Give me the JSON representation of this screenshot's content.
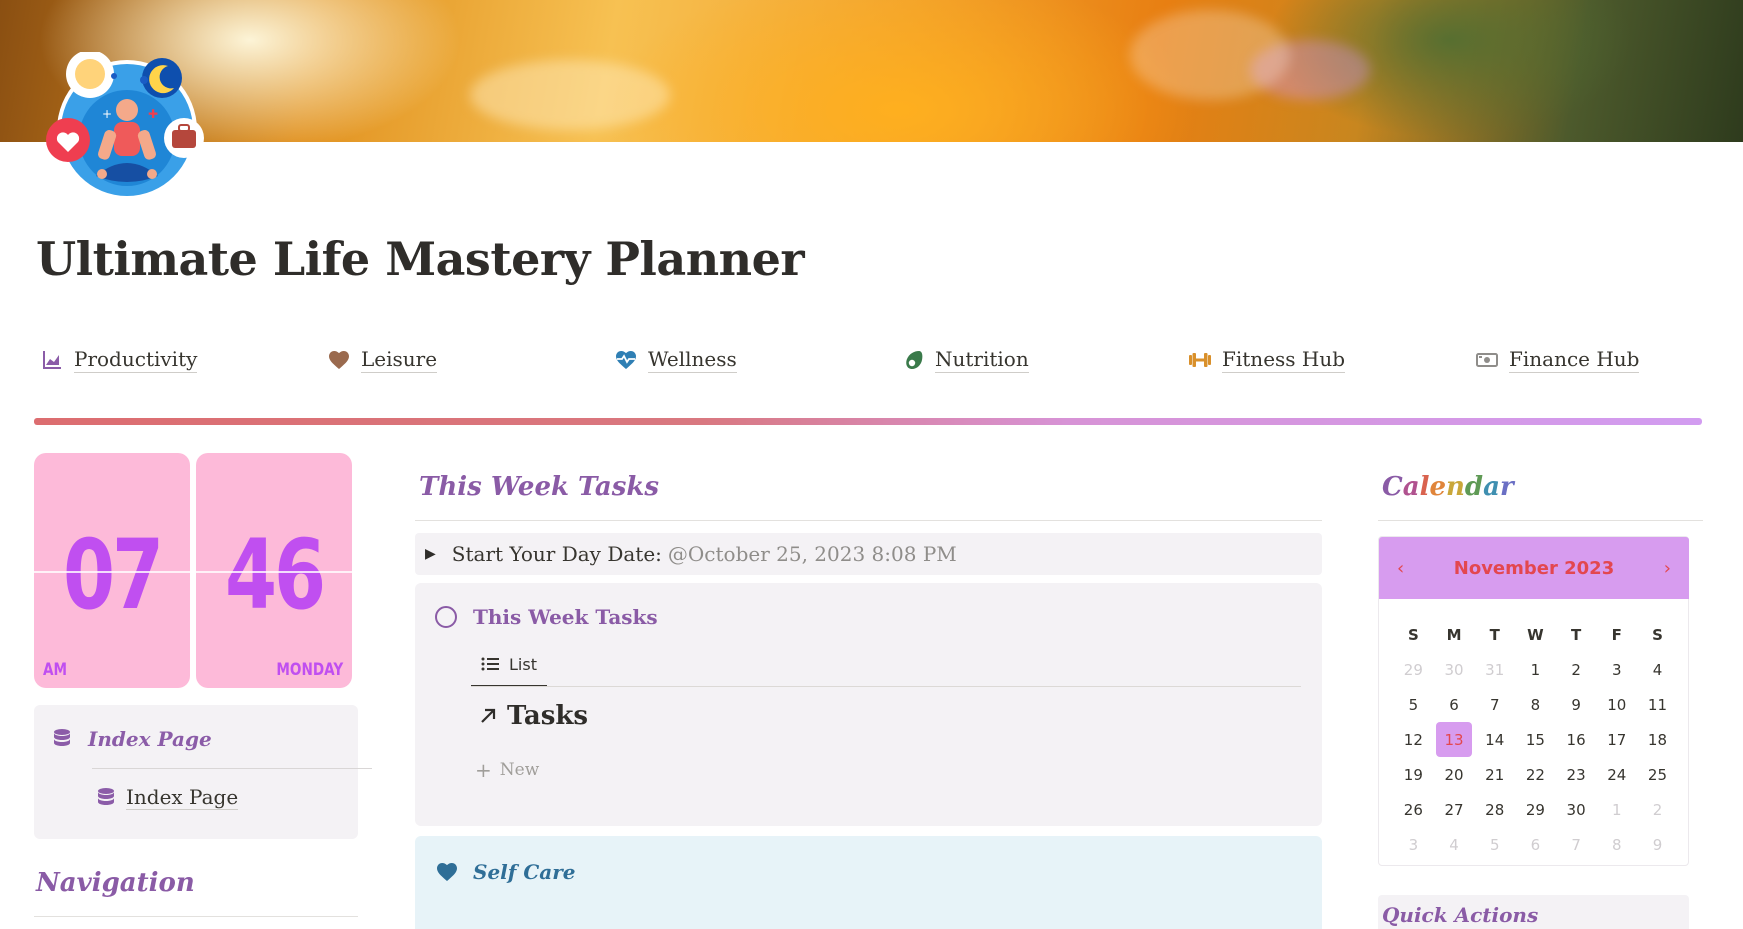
{
  "page": {
    "title": "Ultimate Life Mastery Planner"
  },
  "nav_links": [
    {
      "label": "Productivity",
      "icon": "chart-icon",
      "color": "#8b5ca8"
    },
    {
      "label": "Leisure",
      "icon": "heart-icon",
      "color": "#9a6a4e"
    },
    {
      "label": "Wellness",
      "icon": "heartbeat-icon",
      "color": "#2f7fb4"
    },
    {
      "label": "Nutrition",
      "icon": "avocado-icon",
      "color": "#3a7a4a"
    },
    {
      "label": "Fitness Hub",
      "icon": "dumbbell-icon",
      "color": "#d9902b"
    },
    {
      "label": "Finance Hub",
      "icon": "money-icon",
      "color": "#8f8d8a"
    }
  ],
  "clock": {
    "hour": "07",
    "minute": "46",
    "meridiem": "AM",
    "weekday": "MONDAY"
  },
  "index_section": {
    "heading": "Index Page",
    "item": "Index Page"
  },
  "navigation": {
    "heading": "Navigation"
  },
  "week": {
    "heading": "This Week Tasks",
    "toggle_label": "Start Your Day Date:",
    "toggle_value": "@October 25, 2023 8:08 PM",
    "card_heading": "This Week Tasks",
    "view_tab": "List",
    "database_title": "Tasks",
    "new_label": "New"
  },
  "self_care": {
    "heading": "Self Care"
  },
  "calendar": {
    "heading": "Calendar",
    "month_label": "November 2023",
    "prev": "‹",
    "next": "›",
    "weekdays": [
      "S",
      "M",
      "T",
      "W",
      "T",
      "F",
      "S"
    ],
    "weeks": [
      [
        {
          "d": "29",
          "m": true
        },
        {
          "d": "30",
          "m": true
        },
        {
          "d": "31",
          "m": true
        },
        {
          "d": "1"
        },
        {
          "d": "2"
        },
        {
          "d": "3"
        },
        {
          "d": "4"
        }
      ],
      [
        {
          "d": "5"
        },
        {
          "d": "6"
        },
        {
          "d": "7"
        },
        {
          "d": "8"
        },
        {
          "d": "9"
        },
        {
          "d": "10"
        },
        {
          "d": "11"
        }
      ],
      [
        {
          "d": "12"
        },
        {
          "d": "13",
          "t": true
        },
        {
          "d": "14"
        },
        {
          "d": "15"
        },
        {
          "d": "16"
        },
        {
          "d": "17"
        },
        {
          "d": "18"
        }
      ],
      [
        {
          "d": "19"
        },
        {
          "d": "20"
        },
        {
          "d": "21"
        },
        {
          "d": "22"
        },
        {
          "d": "23"
        },
        {
          "d": "24"
        },
        {
          "d": "25"
        }
      ],
      [
        {
          "d": "26"
        },
        {
          "d": "27"
        },
        {
          "d": "28"
        },
        {
          "d": "29"
        },
        {
          "d": "30"
        },
        {
          "d": "1",
          "m": true
        },
        {
          "d": "2",
          "m": true
        }
      ],
      [
        {
          "d": "3",
          "m": true
        },
        {
          "d": "4",
          "m": true
        },
        {
          "d": "5",
          "m": true
        },
        {
          "d": "6",
          "m": true
        },
        {
          "d": "7",
          "m": true
        },
        {
          "d": "8",
          "m": true
        },
        {
          "d": "9",
          "m": true
        }
      ]
    ]
  },
  "quick_actions": {
    "heading": "Quick Actions"
  },
  "colors": {
    "accent_purple": "#8a5ba6",
    "clock_pink": "#fdbad9",
    "clock_digit": "#c04ff0",
    "calendar_header": "#d79cef",
    "calendar_text": "#e3474f"
  }
}
